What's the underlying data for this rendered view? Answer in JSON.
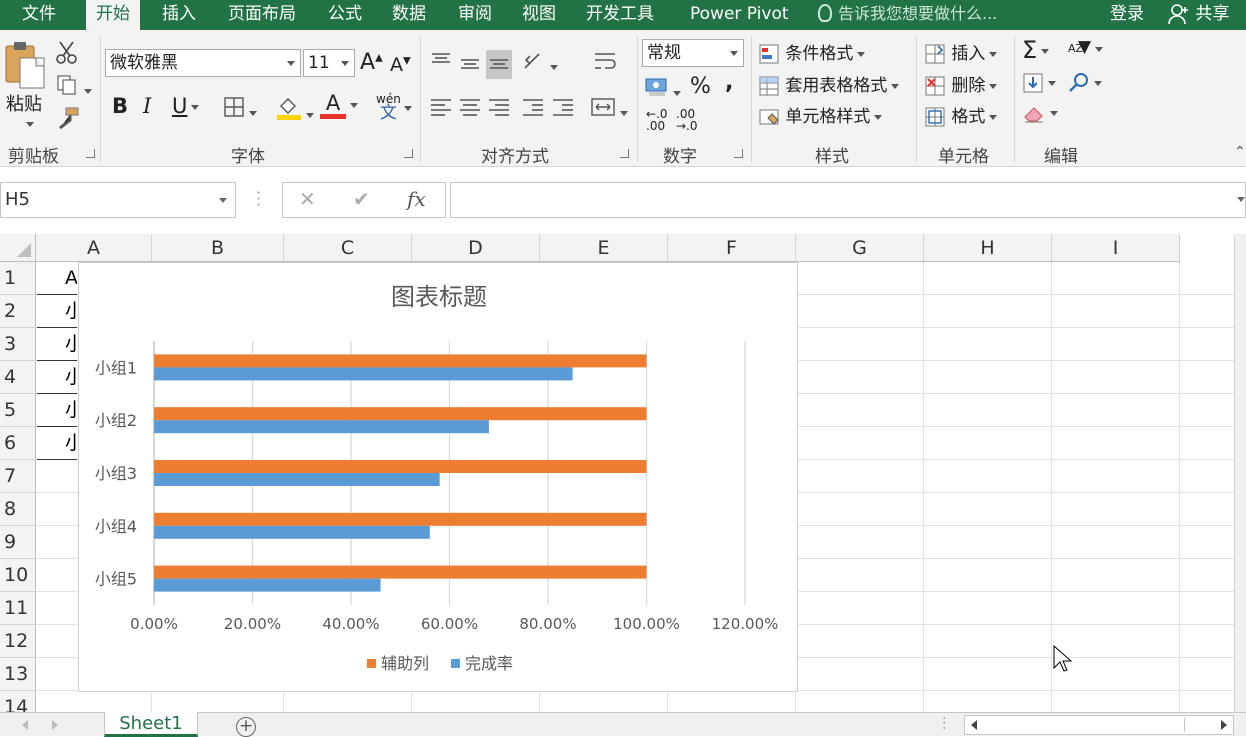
{
  "ribbon_tabs": [
    "文件",
    "开始",
    "插入",
    "页面布局",
    "公式",
    "数据",
    "审阅",
    "视图",
    "开发工具",
    "Power Pivot"
  ],
  "active_tab": "开始",
  "tell_me": "告诉我您想要做什么...",
  "account": {
    "login": "登录",
    "share": "共享"
  },
  "clipboard": {
    "paste": "粘贴",
    "label": "剪贴板"
  },
  "font": {
    "name": "微软雅黑",
    "size": "11",
    "bold": "B",
    "italic": "I",
    "underline": "U",
    "font_color_letter": "A",
    "grow": "A",
    "shrink": "A",
    "phonetic_top": "wén",
    "phonetic_bottom": "文",
    "label": "字体"
  },
  "alignment": {
    "label": "对齐方式"
  },
  "number": {
    "format": "常规",
    "percent": "%",
    "comma": ",",
    "label": "数字"
  },
  "styles": {
    "conditional": "条件格式",
    "table": "套用表格格式",
    "cell": "单元格样式",
    "label": "样式"
  },
  "cells": {
    "insert": "插入",
    "delete": "删除",
    "format": "格式",
    "label": "单元格"
  },
  "editing": {
    "sum": "Σ",
    "sort": "AZ",
    "label": "编辑"
  },
  "formula_bar": {
    "name_box": "H5",
    "cancel": "✕",
    "enter": "✔",
    "fx": "fx",
    "value": ""
  },
  "columns": [
    "A",
    "B",
    "C",
    "D",
    "E",
    "F",
    "G",
    "H",
    "I"
  ],
  "rows": [
    "1",
    "2",
    "3",
    "4",
    "5",
    "6",
    "7",
    "8",
    "9",
    "10",
    "11",
    "12",
    "13",
    "14"
  ],
  "colA_cells": [
    "A",
    "小",
    "小",
    "小",
    "小",
    "小"
  ],
  "sheet_tab": "Sheet1",
  "colors": {
    "accent": "#217346",
    "series1": "#ED7D31",
    "series2": "#5B9BD5"
  },
  "chart_data": {
    "type": "bar",
    "orientation": "horizontal",
    "title": "图表标题",
    "categories": [
      "小组1",
      "小组2",
      "小组3",
      "小组4",
      "小组5"
    ],
    "series": [
      {
        "name": "辅助列",
        "values": [
          1.0,
          1.0,
          1.0,
          1.0,
          1.0
        ]
      },
      {
        "name": "完成率",
        "values": [
          0.85,
          0.68,
          0.58,
          0.56,
          0.46
        ]
      }
    ],
    "xlim": [
      0,
      1.2
    ],
    "xticks": [
      "0.00%",
      "20.00%",
      "40.00%",
      "60.00%",
      "80.00%",
      "100.00%",
      "120.00%"
    ],
    "grid": true,
    "legend": "bottom"
  }
}
